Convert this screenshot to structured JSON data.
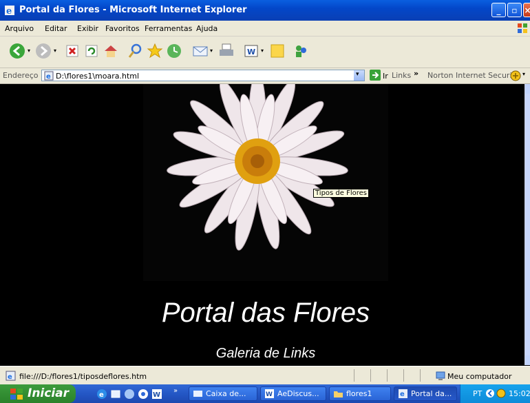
{
  "window": {
    "title": "Portal da Flores - Microsoft Internet Explorer"
  },
  "menu": [
    "Arquivo",
    "Editar",
    "Exibir",
    "Favoritos",
    "Ferramentas",
    "Ajuda"
  ],
  "address": {
    "label": "Endereço",
    "url": "D:\\flores1\\moara.html",
    "go_label": "Ir"
  },
  "links": {
    "label": "Links",
    "norton": "Norton Internet Security"
  },
  "page": {
    "title": "Portal das Flores",
    "subtitle": "Galeria de Links",
    "tooltip": "Tipos de Flores"
  },
  "status": {
    "text": "file:///D:/flores1/tiposdeflores.htm",
    "zone": "Meu computador"
  },
  "taskbar": {
    "start_label": "Iniciar",
    "tasks": [
      {
        "label": "Caixa de..."
      },
      {
        "label": "AeDiscus..."
      },
      {
        "label": "flores1"
      },
      {
        "label": "Portal da..."
      }
    ],
    "lang": "PT",
    "clock": "15:02"
  },
  "colors": {
    "accent": "#0a5fe0",
    "page_bg": "#000000",
    "flower_center": "#e0a010"
  }
}
